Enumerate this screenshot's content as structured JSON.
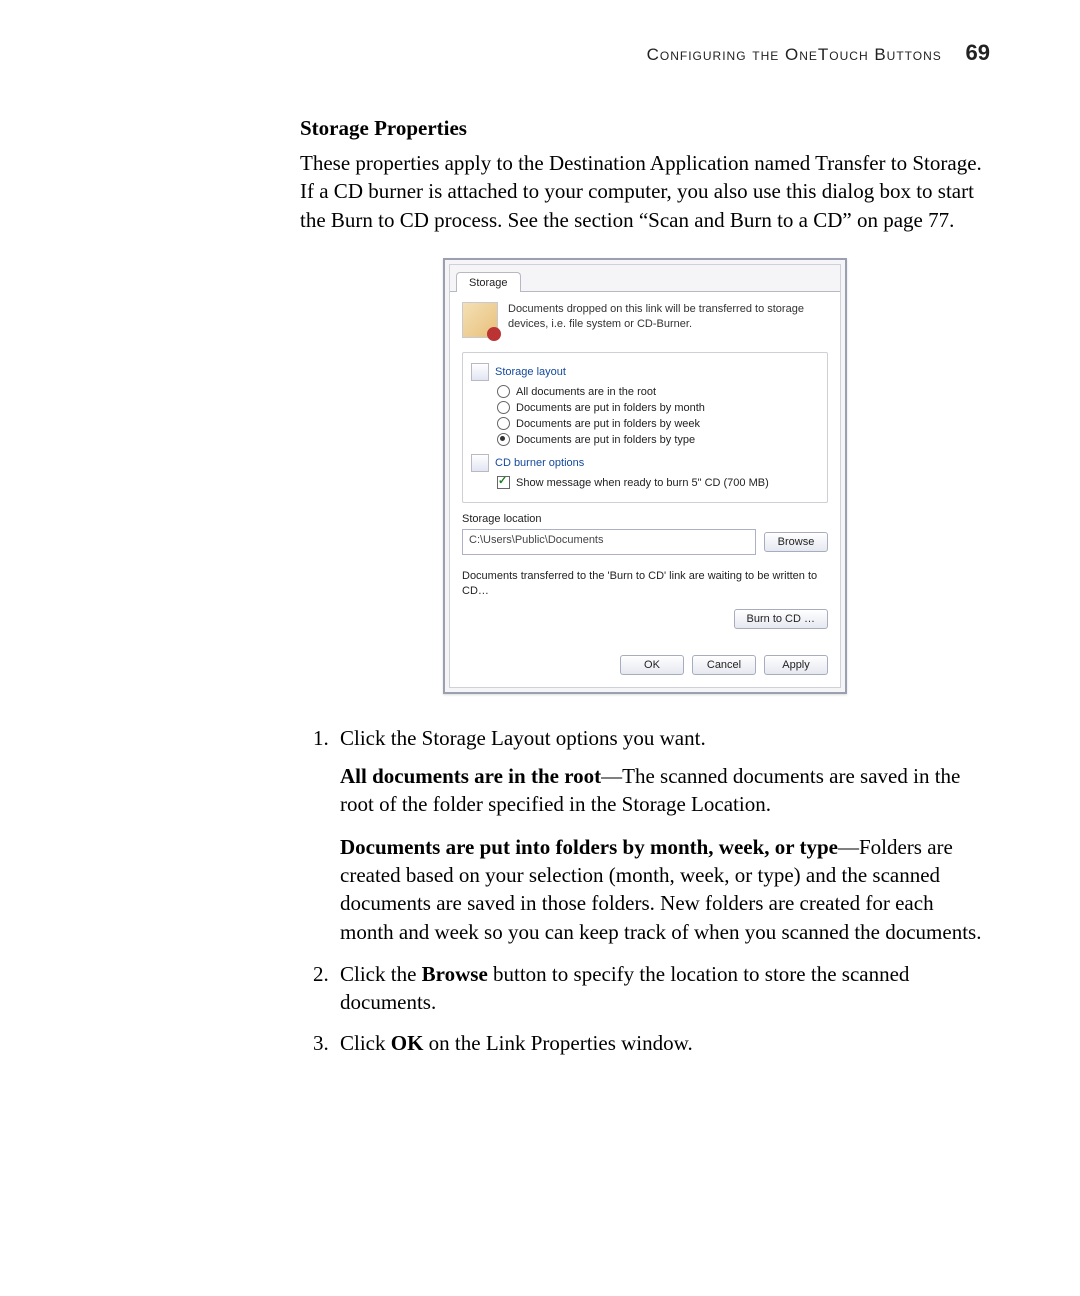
{
  "header": {
    "running_head": "Configuring the OneTouch Buttons",
    "page_number": "69"
  },
  "section": {
    "title": "Storage Properties",
    "intro": "These properties apply to the Destination Application named Transfer to Storage. If a CD burner is attached to your computer, you also use this dialog box to start the Burn to CD process. See the section “Scan and Burn to a CD” on page 77."
  },
  "dialog": {
    "tab_label": "Storage",
    "intro_text": "Documents dropped on this link will be transferred to storage devices, i.e. file system or CD-Burner.",
    "group_storage_title": "Storage layout",
    "opts": {
      "root": "All documents are in the root",
      "by_month": "Documents are put in folders by month",
      "by_week": "Documents are put in folders by week",
      "by_type": "Documents are put in folders by type"
    },
    "group_cd_title": "CD burner options",
    "cd_checkbox": "Show message when ready to burn 5\" CD (700 MB)",
    "location_label": "Storage location",
    "path_value": "C:\\Users\\Public\\Documents",
    "browse_label": "Browse",
    "burn_hint": "Documents transferred to the 'Burn to CD' link are waiting to be written to CD…",
    "burn_button": "Burn to CD …",
    "ok_label": "OK",
    "cancel_label": "Cancel",
    "apply_label": "Apply"
  },
  "steps": {
    "item1": "Click the Storage Layout options you want.",
    "item1_p1_lead": "All documents are in the root",
    "item1_p1_rest": "—The scanned documents are saved in the root of the folder specified in the Storage Location.",
    "item1_p2_lead": "Documents are put into folders by month, week, or type",
    "item1_p2_rest": "—Folders are created based on your selection (month, week, or type) and the scanned documents are saved in those folders. New folders are created for each month and week so you can keep track of when you scanned the documents.",
    "item2_pre": "Click the ",
    "item2_bold": "Browse",
    "item2_post": " button to specify the location to store the scanned documents.",
    "item3_pre": "Click ",
    "item3_bold": "OK",
    "item3_post": " on the Link Properties window."
  }
}
